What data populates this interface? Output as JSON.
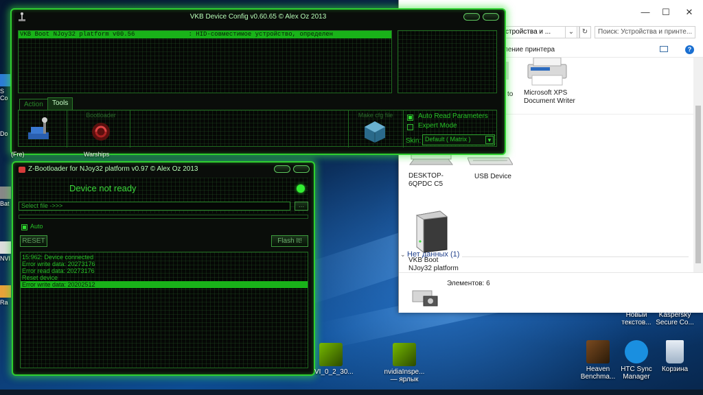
{
  "vkb_config": {
    "title": "VKB Device Config v0.60.65 © Alex Oz 2013",
    "device_row_name": "VKB Boot NJoy32 platform  v00.56",
    "device_row_desc": ": HID-совместимое устройство, определен",
    "tabs": [
      "Action",
      "Tools"
    ],
    "tools": {
      "bootloader_label": "Bootloader",
      "make_cfg_label": "Make cfg file"
    },
    "auto_read_label": "Auto Read Parameters",
    "auto_read_checked": true,
    "expert_mode_label": "Expert Mode",
    "expert_mode_checked": false,
    "skin_label": "Skin:",
    "skin_value": "Default ( Matrix )"
  },
  "bootloader": {
    "title": "Z-Bootloader for NJoy32 platform v0.97 © Alex Oz 2013",
    "status": "Device not ready",
    "file_placeholder": "Select file ->>>",
    "browse_label": "...",
    "auto_label": "Auto",
    "auto_checked": true,
    "reset_label": "RESET",
    "flash_label": "Flash It!",
    "log": [
      "15:962: Device connected",
      "Error write data: 20273176",
      "Error read data: 20273176",
      "Reset device",
      "Error write data: 20202512"
    ],
    "log_selected_index": 4
  },
  "explorer": {
    "address": "стройства и ...",
    "search_placeholder": "Поиск: Устройства и принте...",
    "toolbar_label": "ление принтера",
    "help_label": "?",
    "partial_label": "to",
    "devices": [
      {
        "label": "Microsoft XPS Document Writer"
      },
      {
        "label": "DESKTOP-6QPDC C5"
      },
      {
        "label": "USB Device"
      },
      {
        "label": "VKB Boot NJoy32 platform"
      }
    ],
    "group_header": "Нет данных (1)",
    "status_count": "Элементов: 6"
  },
  "desktop_icons": [
    {
      "label": "Новый текстов..."
    },
    {
      "label": "Kaspersky Secure Co..."
    },
    {
      "label": "Heaven Benchma..."
    },
    {
      "label": "HTC Sync Manager"
    },
    {
      "label": "Корзина"
    },
    {
      "label": "nvidiaInspe... — ярлык"
    },
    {
      "label": "VI_0_2_30..."
    }
  ],
  "edge_labels": [
    "S",
    "Co",
    "Do",
    "Bat",
    "NVI",
    "Ra"
  ],
  "hidden_labels": [
    "(Fre)",
    "Warships"
  ],
  "colors": {
    "accent_green": "#2fcf2f",
    "selection_green": "#19b319",
    "status_led": "#33ee33",
    "explorer_link": "#1e3e8a"
  }
}
